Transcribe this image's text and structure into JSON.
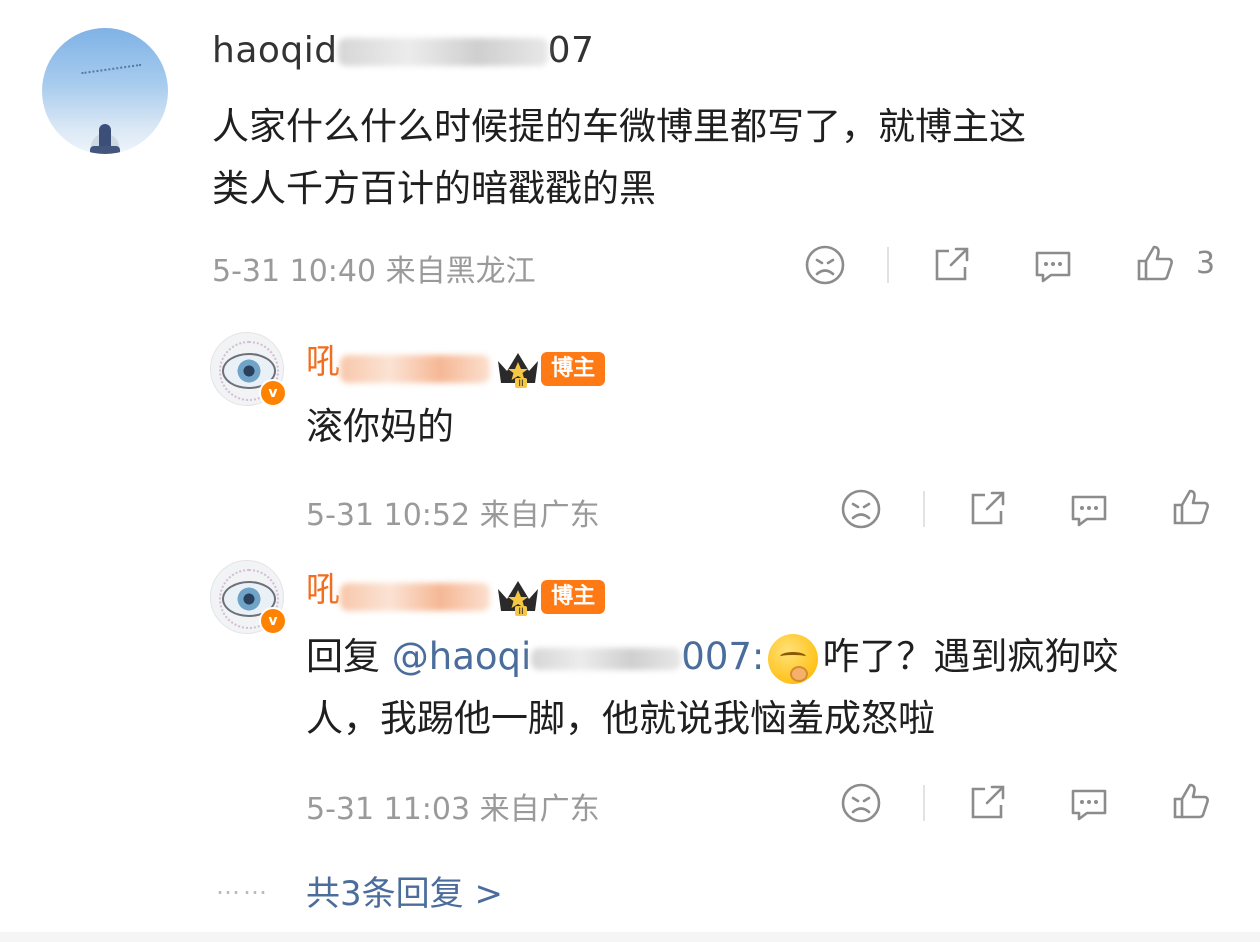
{
  "comment": {
    "username_prefix": "haoqid",
    "username_suffix": "07",
    "text_line1": "人家什么什么时候提的车微博里都写了，就博主这",
    "text_line2": "类人千方百计的暗戳戳的黑",
    "timestamp": "5-31 10:40",
    "location": "来自黑龙江",
    "like_count": "3"
  },
  "replies": [
    {
      "username_prefix": "吼",
      "badge_label": "博主",
      "text_line1": "滚你妈的",
      "timestamp": "5-31 10:52",
      "location": "来自广东"
    },
    {
      "username_prefix": "吼",
      "badge_label": "博主",
      "reply_prefix": "回复",
      "mention_prefix": "@haoqi",
      "mention_suffix": "007:",
      "text_line1_after": "咋了？遇到疯狗咬",
      "text_line2": "人，我踢他一脚，他就说我恼羞成怒啦",
      "timestamp": "5-31 11:03",
      "location": "来自广东"
    }
  ],
  "footer": {
    "dots": "……",
    "more_replies": "共3条回复 >"
  },
  "colors": {
    "blogger_name": "#f26d1f",
    "badge_bg": "#ff7a14",
    "link": "#4a6d9b",
    "meta": "#9a9a9a"
  },
  "icons": [
    "dislike-icon",
    "share-icon",
    "comment-icon",
    "like-icon"
  ]
}
